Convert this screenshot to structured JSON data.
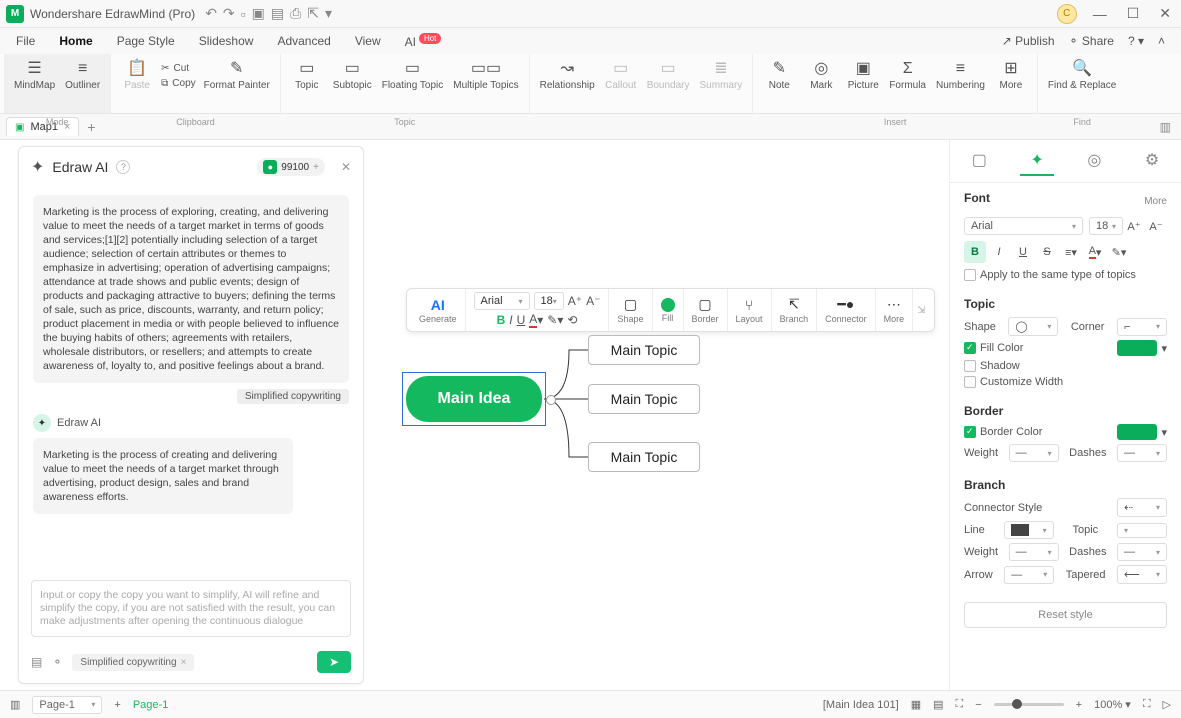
{
  "app": {
    "title": "Wondershare EdrawMind (Pro)",
    "avatar_letter": "C"
  },
  "menubar": {
    "items": [
      "File",
      "Home",
      "Page Style",
      "Slideshow",
      "Advanced",
      "View"
    ],
    "ai_label": "AI",
    "ai_badge": "Hot",
    "publish": "Publish",
    "share": "Share"
  },
  "ribbon": {
    "mode": {
      "mindmap": "MindMap",
      "outliner": "Outliner",
      "group": "Mode"
    },
    "clipboard": {
      "paste": "Paste",
      "cut": "Cut",
      "copy": "Copy",
      "format_painter": "Format\nPainter",
      "group": "Clipboard"
    },
    "topic": {
      "topic": "Topic",
      "subtopic": "Subtopic",
      "floating": "Floating\nTopic",
      "multiple": "Multiple\nTopics",
      "group": "Topic"
    },
    "relationship": "Relationship",
    "callout": "Callout",
    "boundary": "Boundary",
    "summary": "Summary",
    "insert": {
      "note": "Note",
      "mark": "Mark",
      "picture": "Picture",
      "formula": "Formula",
      "numbering": "Numbering",
      "more": "More",
      "group": "Insert"
    },
    "find": {
      "find_replace": "Find &\nReplace",
      "group": "Find"
    }
  },
  "tabs": {
    "name": "Map1"
  },
  "ai_panel": {
    "title": "Edraw AI",
    "tokens": "99100",
    "user_msg": "Marketing is the process of exploring, creating, and delivering value to meet the needs of a target market in terms of goods and services;[1][2] potentially including selection of a target audience; selection of certain attributes or themes to emphasize in advertising; operation of advertising campaigns; attendance at trade shows and public events; design of products and packaging attractive to buyers; defining the terms of sale, such as price, discounts, warranty, and return policy; product placement in media or with people believed to influence the buying habits of others; agreements with retailers, wholesale distributors, or resellers; and attempts to create awareness of, loyalty to, and positive feelings about a brand.",
    "chip": "Simplified copywriting",
    "bot_name": "Edraw AI",
    "bot_msg": "Marketing is the process of creating and delivering value to meet the needs of a target market through advertising, product design, sales and brand awareness efforts.",
    "input_hint": "Input or copy the copy you want to simplify, AI will refine and simplify the copy, if you are not satisfied with the result, you can make adjustments after opening the continuous dialogue",
    "footer_tag": "Simplified copywriting"
  },
  "floating_toolbar": {
    "generate": "Generate",
    "ai": "AI",
    "font": "Arial",
    "size": "18",
    "shape": "Shape",
    "fill": "Fill",
    "border": "Border",
    "layout": "Layout",
    "branch": "Branch",
    "connector": "Connector",
    "more": "More"
  },
  "mindmap": {
    "main": "Main Idea",
    "topic": "Main Topic"
  },
  "props": {
    "font": {
      "heading": "Font",
      "more": "More",
      "family": "Arial",
      "size": "18",
      "apply_same": "Apply to the same type of topics"
    },
    "topic": {
      "heading": "Topic",
      "shape": "Shape",
      "corner": "Corner",
      "fill_color": "Fill Color",
      "shadow": "Shadow",
      "custom_width": "Customize Width"
    },
    "border": {
      "heading": "Border",
      "border_color": "Border Color",
      "weight": "Weight",
      "dashes": "Dashes"
    },
    "branch": {
      "heading": "Branch",
      "connector_style": "Connector Style",
      "line": "Line",
      "topic": "Topic",
      "weight": "Weight",
      "dashes": "Dashes",
      "arrow": "Arrow",
      "tapered": "Tapered"
    },
    "reset": "Reset style"
  },
  "statusbar": {
    "page_sel": "Page-1",
    "page_tab": "Page-1",
    "selection": "[Main Idea 101]",
    "zoom": "100%"
  }
}
